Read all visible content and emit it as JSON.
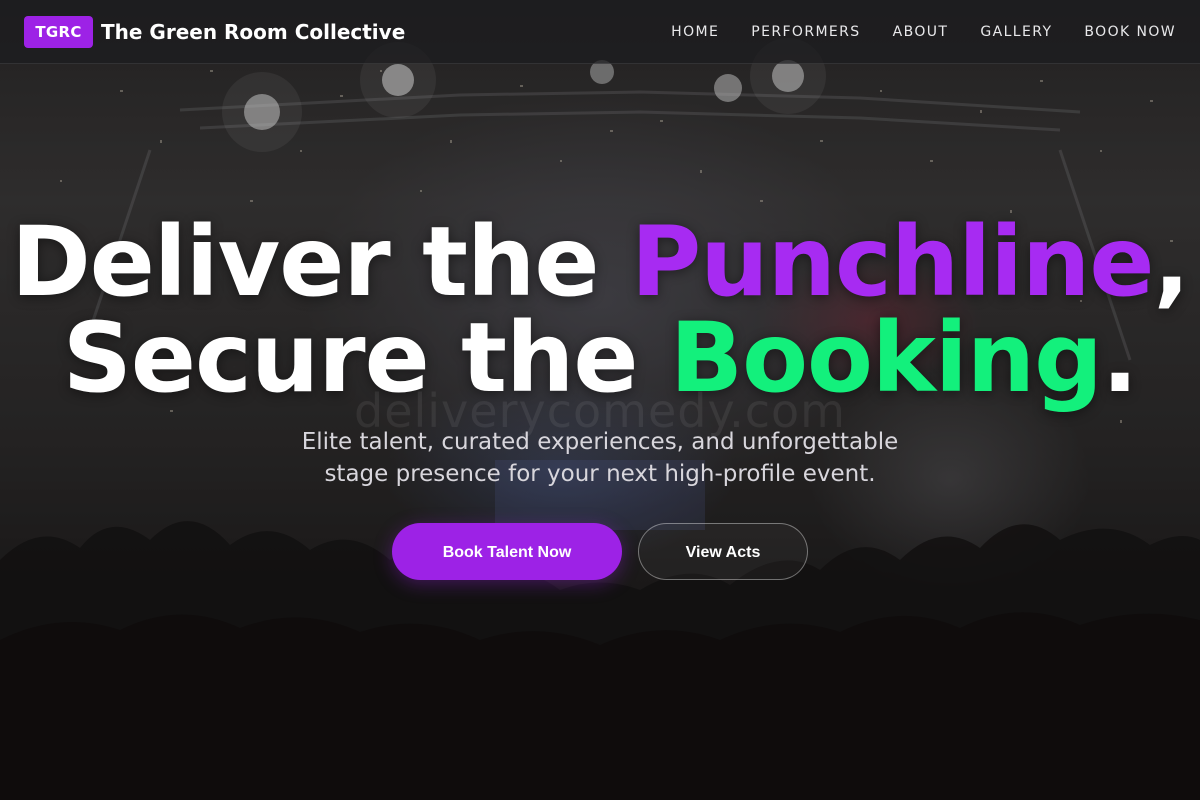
{
  "nav": {
    "logo_badge": "TGRC",
    "brand_name": "The Green Room Collective",
    "links": [
      "HOME",
      "PERFORMERS",
      "ABOUT",
      "GALLERY",
      "BOOK NOW"
    ]
  },
  "hero": {
    "title_line1_prefix": "Deliver the ",
    "title_line1_highlight": "Punchline",
    "title_line1_suffix": ",",
    "title_line2_prefix": "Secure the ",
    "title_line2_highlight": "Booking",
    "title_line2_suffix": ".",
    "watermark": "deliverycomedy.com",
    "subtitle_line1": "Elite talent, curated experiences, and unforgettable",
    "subtitle_line2": "stage presence for your next high-profile event.",
    "primary_button": "Book Talent Now",
    "secondary_button": "View Acts"
  },
  "colors": {
    "accent_purple": "#9d22e6",
    "highlight_purple": "#a72bf2",
    "highlight_green": "#13f07c",
    "background": "#1a1818"
  }
}
